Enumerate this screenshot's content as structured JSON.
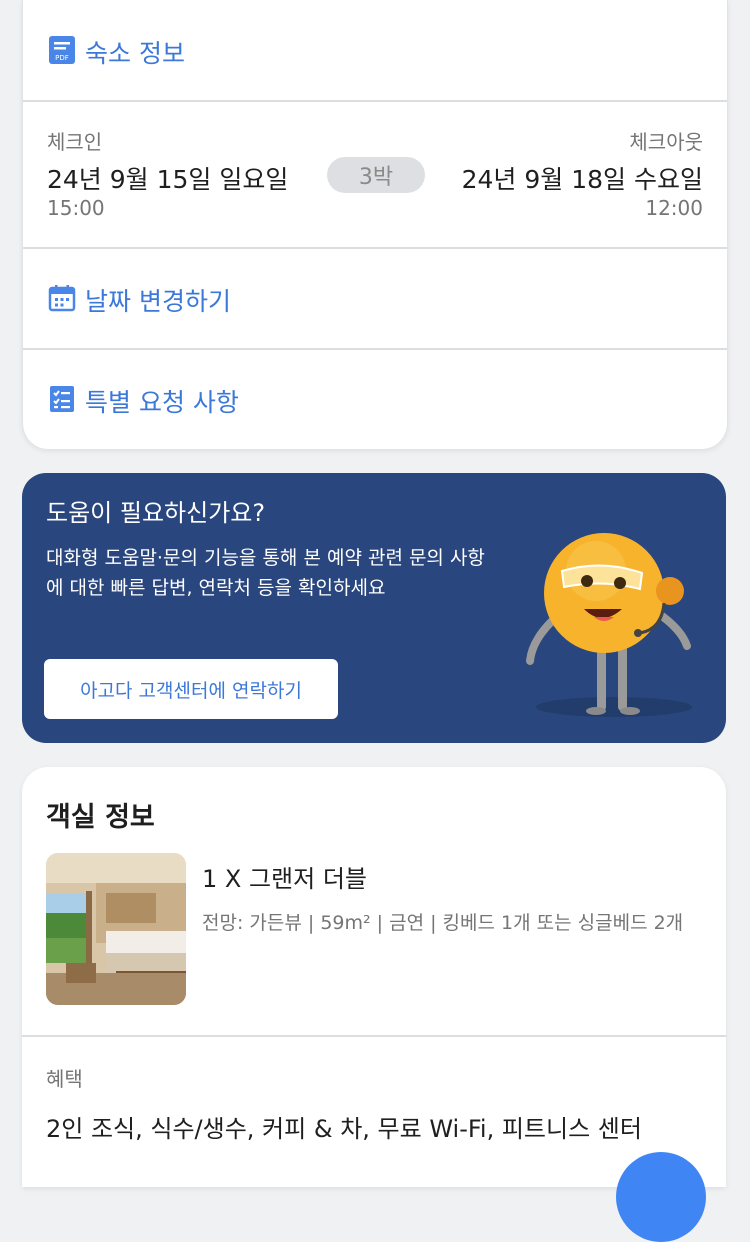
{
  "booking": {
    "property_info_label": "숙소 정보",
    "checkin": {
      "label": "체크인",
      "date": "24년 9월 15일 일요일",
      "time": "15:00"
    },
    "nights": "3박",
    "checkout": {
      "label": "체크아웃",
      "date": "24년 9월 18일 수요일",
      "time": "12:00"
    },
    "change_dates_label": "날짜 변경하기",
    "special_requests_label": "특별 요청 사항"
  },
  "help": {
    "title": "도움이 필요하신가요?",
    "description": "대화형 도움말·문의 기능을 통해 본 예약 관련 문의 사항에 대한 빠른 답변, 연락처 등을 확인하세요",
    "contact_button": "아고다 고객센터에 연락하기"
  },
  "room": {
    "section_title": "객실 정보",
    "name": "1 X 그랜저 더블",
    "details": "전망: 가든뷰 | 59m² | 금연 | 킹베드 1개 또는 싱글베드 2개",
    "benefits_label": "혜택",
    "benefits": "2인 조식, 식수/생수, 커피 & 차, 무료 Wi-Fi, 피트니스 센터"
  },
  "colors": {
    "accent": "#3c78d8",
    "help_bg": "#29467e",
    "mascot": "#f7b32b",
    "fab": "#3f86f4"
  },
  "icons": {
    "property_info": "pdf-icon",
    "change_dates": "calendar-icon",
    "special_requests": "checklist-icon"
  }
}
